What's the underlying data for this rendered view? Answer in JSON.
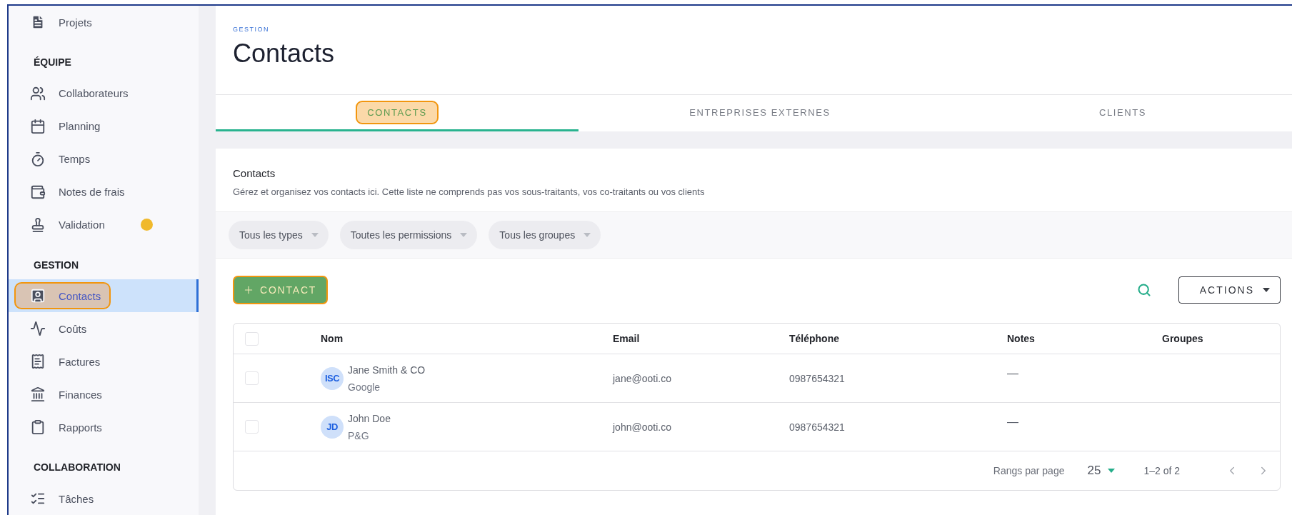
{
  "sidebar": {
    "entries": [
      {
        "kind": "link",
        "label": "Projets",
        "selected": false,
        "highlighted": false,
        "dot": false
      },
      {
        "kind": "heading",
        "label": "ÉQUIPE"
      },
      {
        "kind": "link",
        "label": "Collaborateurs",
        "selected": false,
        "highlighted": false,
        "dot": false
      },
      {
        "kind": "link",
        "label": "Planning",
        "selected": false,
        "highlighted": false,
        "dot": false
      },
      {
        "kind": "link",
        "label": "Temps",
        "selected": false,
        "highlighted": false,
        "dot": false
      },
      {
        "kind": "link",
        "label": "Notes de frais",
        "selected": false,
        "highlighted": false,
        "dot": false
      },
      {
        "kind": "link",
        "label": "Validation",
        "selected": false,
        "highlighted": false,
        "dot": true
      },
      {
        "kind": "heading",
        "label": "GESTION"
      },
      {
        "kind": "link",
        "label": "Contacts",
        "selected": true,
        "highlighted": true,
        "dot": false
      },
      {
        "kind": "link",
        "label": "Coûts",
        "selected": false,
        "highlighted": false,
        "dot": false
      },
      {
        "kind": "link",
        "label": "Factures",
        "selected": false,
        "highlighted": false,
        "dot": false
      },
      {
        "kind": "link",
        "label": "Finances",
        "selected": false,
        "highlighted": false,
        "dot": false
      },
      {
        "kind": "link",
        "label": "Rapports",
        "selected": false,
        "highlighted": false,
        "dot": false
      },
      {
        "kind": "heading",
        "label": "COLLABORATION"
      },
      {
        "kind": "link",
        "label": "Tâches",
        "selected": false,
        "highlighted": false,
        "dot": false
      }
    ]
  },
  "header": {
    "breadcrumb": "GESTION",
    "title": "Contacts"
  },
  "tabs": [
    {
      "label": "CONTACTS",
      "selected": true,
      "highlighted": true
    },
    {
      "label": "ENTREPRISES EXTERNES",
      "selected": false,
      "highlighted": false
    },
    {
      "label": "CLIENTS",
      "selected": false,
      "highlighted": false
    }
  ],
  "card": {
    "title": "Contacts",
    "description": "Gérez et organisez vos contacts ici. Cette liste ne comprends pas vos sous-traitants, vos co-traitants ou vos clients"
  },
  "filters": [
    {
      "label": "Tous les types"
    },
    {
      "label": "Toutes les permissions"
    },
    {
      "label": "Tous les groupes"
    }
  ],
  "toolbar": {
    "add_button": {
      "label": "CONTACT",
      "highlighted": true
    },
    "actions_button": {
      "label": "ACTIONS"
    }
  },
  "table": {
    "columns": [
      "Nom",
      "Email",
      "Téléphone",
      "Notes",
      "Groupes"
    ],
    "header_checked": false,
    "rows": [
      {
        "checked": false,
        "initials": "ISC",
        "name": "Jane Smith & CO",
        "company": "Google",
        "email": "jane@ooti.co",
        "phone": "0987654321",
        "notes": "—"
      },
      {
        "checked": false,
        "initials": "JD",
        "name": "John Doe",
        "company": "P&G",
        "email": "john@ooti.co",
        "phone": "0987654321",
        "notes": "—"
      }
    ]
  },
  "pagination": {
    "rows_label": "Rangs par page",
    "per_page": "25",
    "range": "1–2 of 2"
  }
}
